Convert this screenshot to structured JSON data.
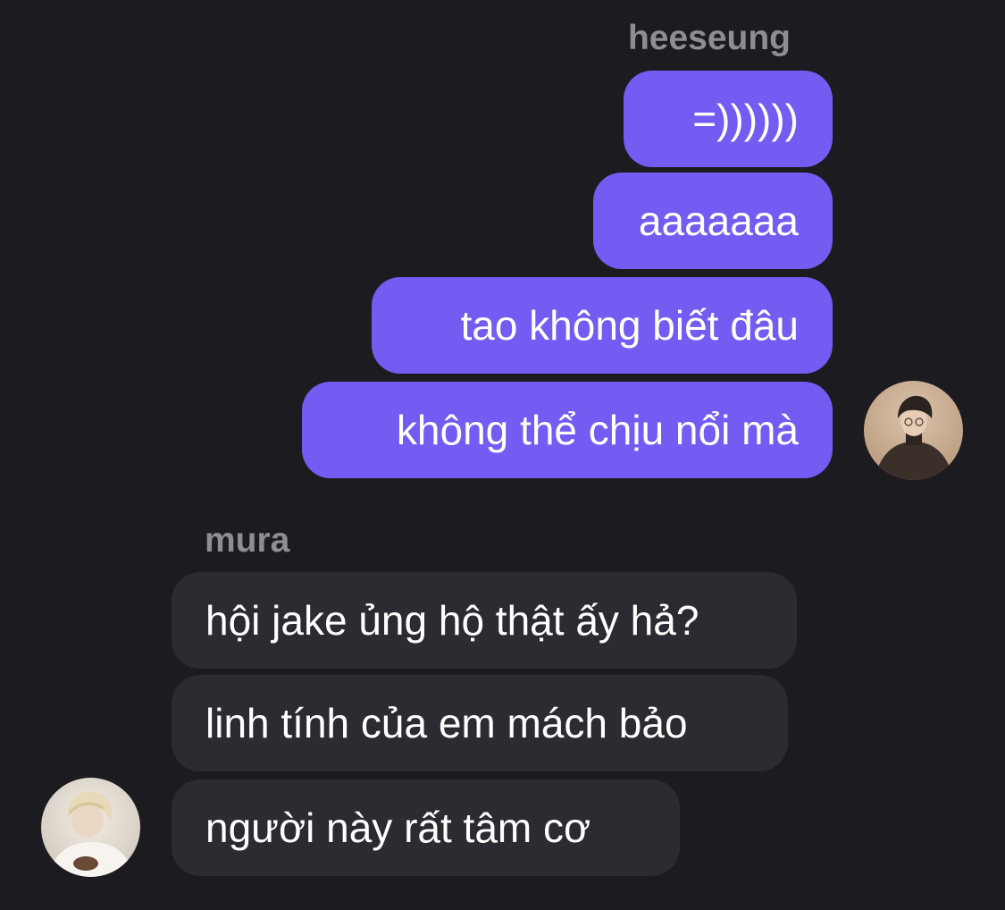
{
  "conversation": {
    "outgoing_group": {
      "sender": "heeseung",
      "avatar_icon": "user-avatar-icon",
      "messages": [
        "=))))))",
        "aaaaaaa",
        "tao không biết đâu",
        "không thể chịu nổi mà"
      ]
    },
    "incoming_group": {
      "sender": "mura",
      "avatar_icon": "user-avatar-icon",
      "messages": [
        "hội jake ủng hộ thật ấy hả?",
        "linh tính của em mách bảo",
        "người này rất tâm cơ"
      ]
    }
  },
  "colors": {
    "background": "#1c1b20",
    "outgoing_bubble": "#745bf1",
    "incoming_bubble": "#2c2b31",
    "sender_name": "#8e8d93",
    "message_text": "#ffffff"
  }
}
